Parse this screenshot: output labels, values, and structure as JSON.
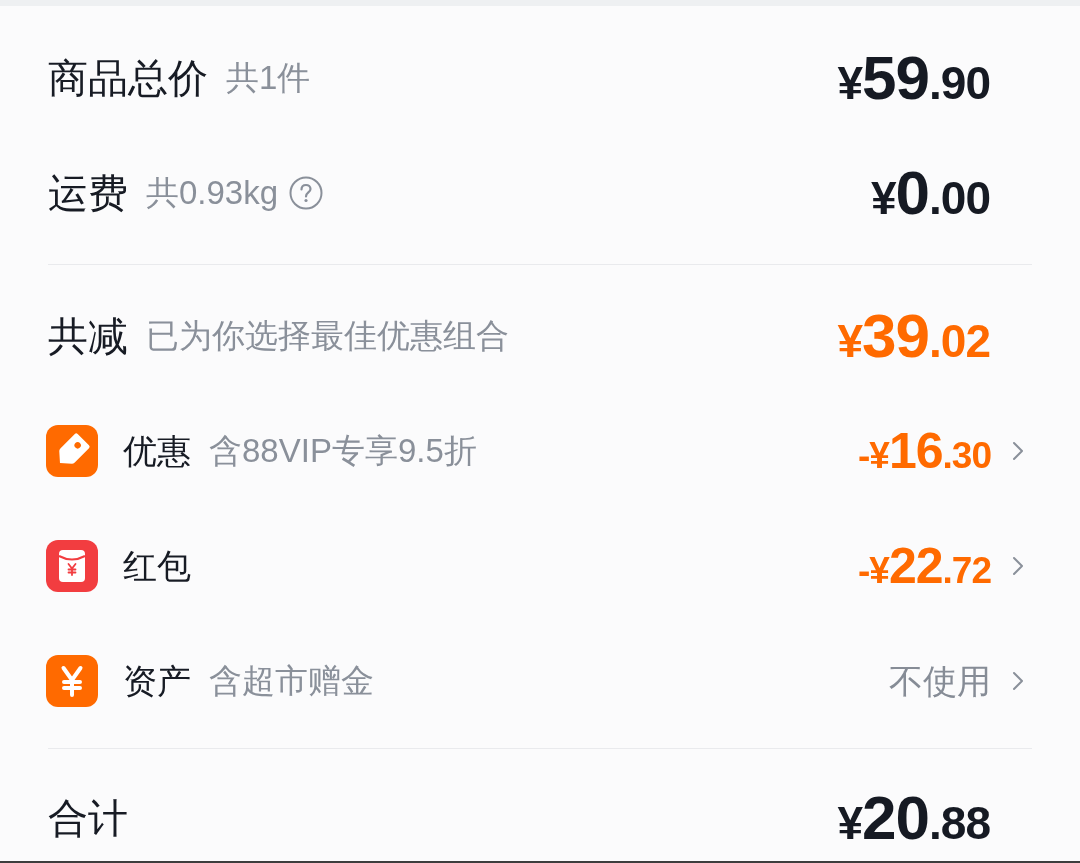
{
  "summary": [
    {
      "label": "商品总价",
      "note": "共1件",
      "help": false,
      "amount": "¥59.90"
    },
    {
      "label": "运费",
      "note": "共0.93kg",
      "help": true,
      "amount": "¥0.00"
    }
  ],
  "discount": {
    "label": "共减",
    "note": "已为你选择最佳优惠组合",
    "amount": "¥39.02"
  },
  "items": [
    {
      "kind": "tag",
      "label": "优惠",
      "note": "含88VIP专享9.5折",
      "amount": "-¥16.30"
    },
    {
      "kind": "red_packet",
      "label": "红包",
      "amount": "-¥22.72"
    },
    {
      "kind": "assets",
      "label": "资产",
      "note": "含超市赠金",
      "value": "不使用"
    }
  ],
  "total": {
    "label": "合计",
    "amount": "¥20.88"
  }
}
